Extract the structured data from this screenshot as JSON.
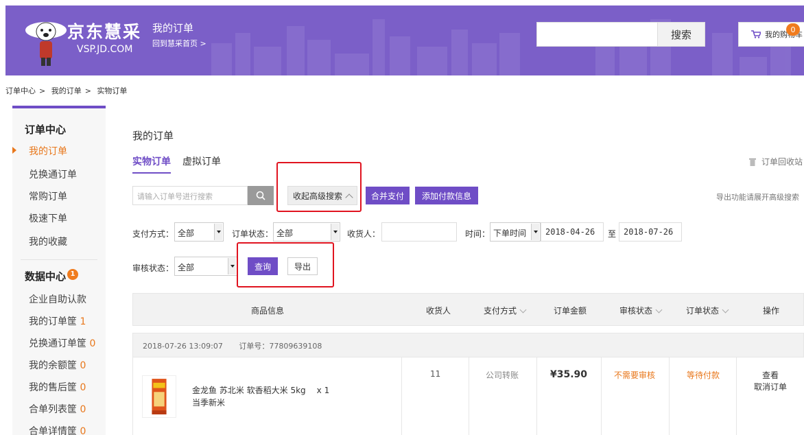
{
  "header": {
    "brand": "京东慧采",
    "brand_sub": "VSP.JD.COM",
    "title": "我的订单",
    "home_link": "回到慧采首页 >",
    "search_placeholder": "",
    "search_button": "搜索",
    "cart_label": "我的购物车",
    "cart_count": "0",
    "colors": {
      "brand_purple": "#7b5fc8",
      "accent_orange": "#f07c1e",
      "button_purple": "#6f4dc6"
    }
  },
  "breadcrumb": [
    "订单中心",
    "我的订单",
    "实物订单"
  ],
  "sidebar": {
    "section1_title": "订单中心",
    "section1_items": [
      "我的订单",
      "兑换通订单",
      "常购订单",
      "极速下单",
      "我的收藏"
    ],
    "active_index": 0,
    "section2_title": "数据中心",
    "section2_badge": "1",
    "section2_items": [
      {
        "label": "企业自助认款",
        "count": ""
      },
      {
        "label": "我的订单筐",
        "count": "1"
      },
      {
        "label": "兑换通订单筐",
        "count": "0"
      },
      {
        "label": "我的余额筐",
        "count": "0"
      },
      {
        "label": "我的售后筐",
        "count": "0"
      },
      {
        "label": "合单列表筐",
        "count": "0"
      },
      {
        "label": "合单详情筐",
        "count": "0"
      }
    ]
  },
  "main": {
    "page_title": "我的订单",
    "tabs": [
      "实物订单",
      "虚拟订单"
    ],
    "recycle_label": "订单回收站",
    "search_placeholder": "请输入订单号进行搜索",
    "adv_toggle": "收起高级搜索",
    "merge_pay": "合并支付",
    "add_payment_info": "添加付款信息",
    "export_tip": "导出功能请展开高级搜索",
    "filters": {
      "pay_method_label": "支付方式：",
      "pay_method_value": "全部",
      "order_status_label": "订单状态：",
      "order_status_value": "全部",
      "receiver_label": "收货人：",
      "receiver_value": "",
      "time_label": "时间：",
      "time_type_value": "下单时间",
      "date_from": "2018-04-26",
      "date_to_sep": "至",
      "date_to": "2018-07-26",
      "audit_label": "审核状态：",
      "audit_value": "全部",
      "query_button": "查询",
      "export_button": "导出"
    },
    "table": {
      "headers": [
        "商品信息",
        "收货人",
        "支付方式",
        "订单金额",
        "审核状态",
        "订单状态",
        "操作"
      ],
      "orders": [
        {
          "time": "2018-07-26 13:09:07",
          "order_no_label": "订单号：",
          "order_no": "77809639108",
          "product_name": "金龙鱼 苏北米 软香稻大米 5kg",
          "product_qty": "x 1",
          "product_sub": "当季新米",
          "receiver": "11",
          "pay_method": "公司转账",
          "amount": "¥35.90",
          "audit_status": "不需要审核",
          "order_status": "等待付款",
          "action_view": "查看",
          "action_cancel": "取消订单"
        }
      ]
    }
  }
}
